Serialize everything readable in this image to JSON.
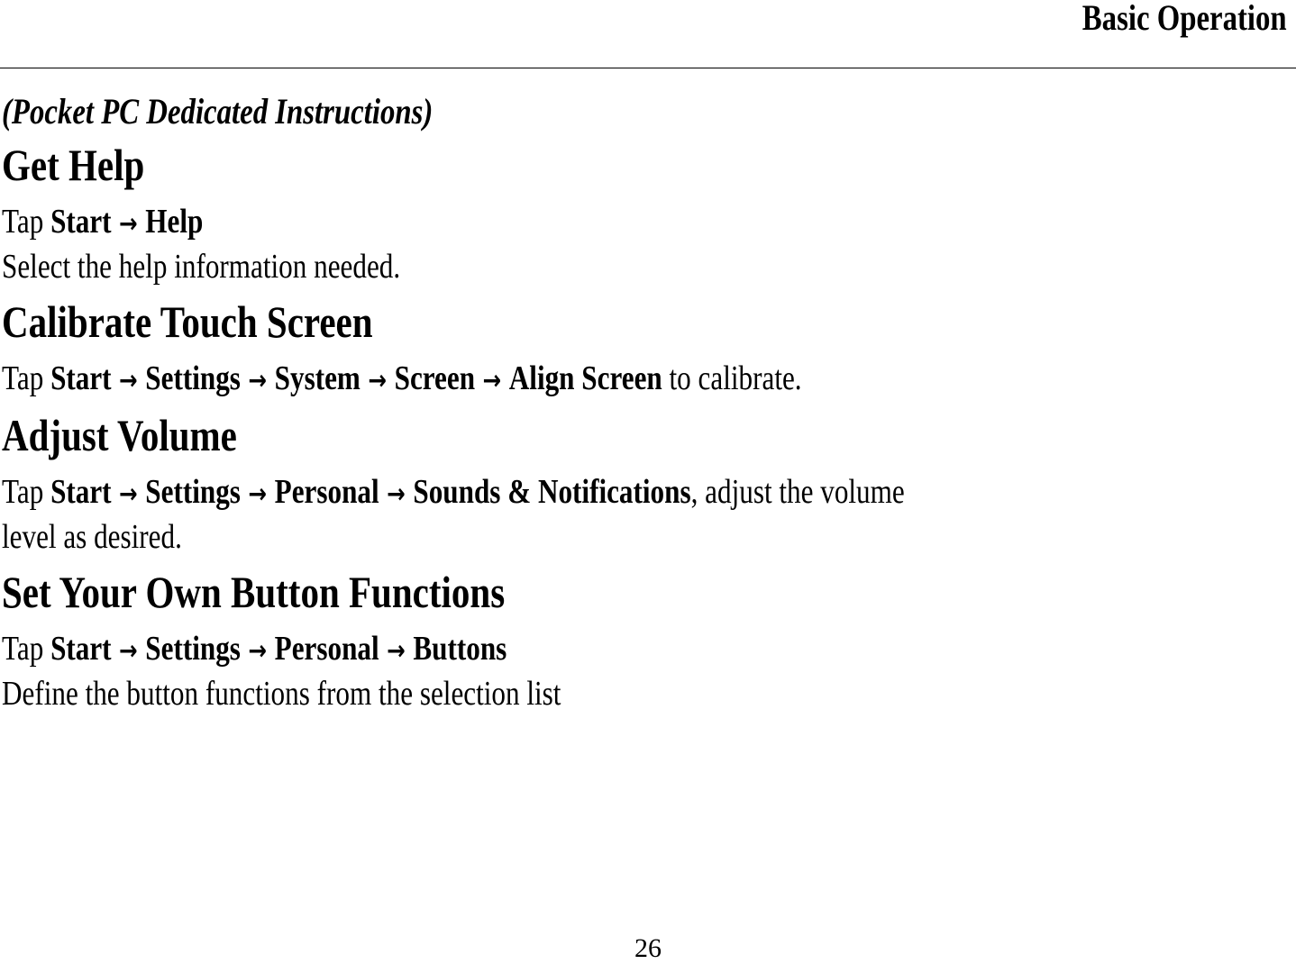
{
  "header": {
    "title": "Basic Operation"
  },
  "subtitle": "(Pocket PC Dedicated Instructions)",
  "arrow_glyph": "→",
  "sections": [
    {
      "heading": "Get Help",
      "lines": [
        {
          "prefix": "Tap ",
          "path": [
            "Start",
            "Help"
          ],
          "suffix": ""
        },
        {
          "text": "Select the help information needed."
        }
      ]
    },
    {
      "heading": "Calibrate Touch Screen",
      "lines": [
        {
          "prefix": "Tap ",
          "path": [
            "Start",
            "Settings",
            "System",
            "Screen",
            "Align Screen"
          ],
          "suffix": " to calibrate."
        }
      ]
    },
    {
      "heading": "Adjust Volume",
      "lines": [
        {
          "prefix": "Tap ",
          "path": [
            "Start",
            "Settings",
            "Personal",
            "Sounds & Notifications"
          ],
          "suffix": ", adjust the volume"
        },
        {
          "text": "level as desired."
        }
      ]
    },
    {
      "heading": "Set Your Own Button Functions",
      "lines": [
        {
          "prefix": "Tap ",
          "path": [
            "Start",
            "Settings",
            "Personal",
            "Buttons"
          ],
          "suffix": ""
        },
        {
          "text": "Define the button functions from the selection list"
        }
      ]
    }
  ],
  "footer": {
    "page_number": "26"
  }
}
